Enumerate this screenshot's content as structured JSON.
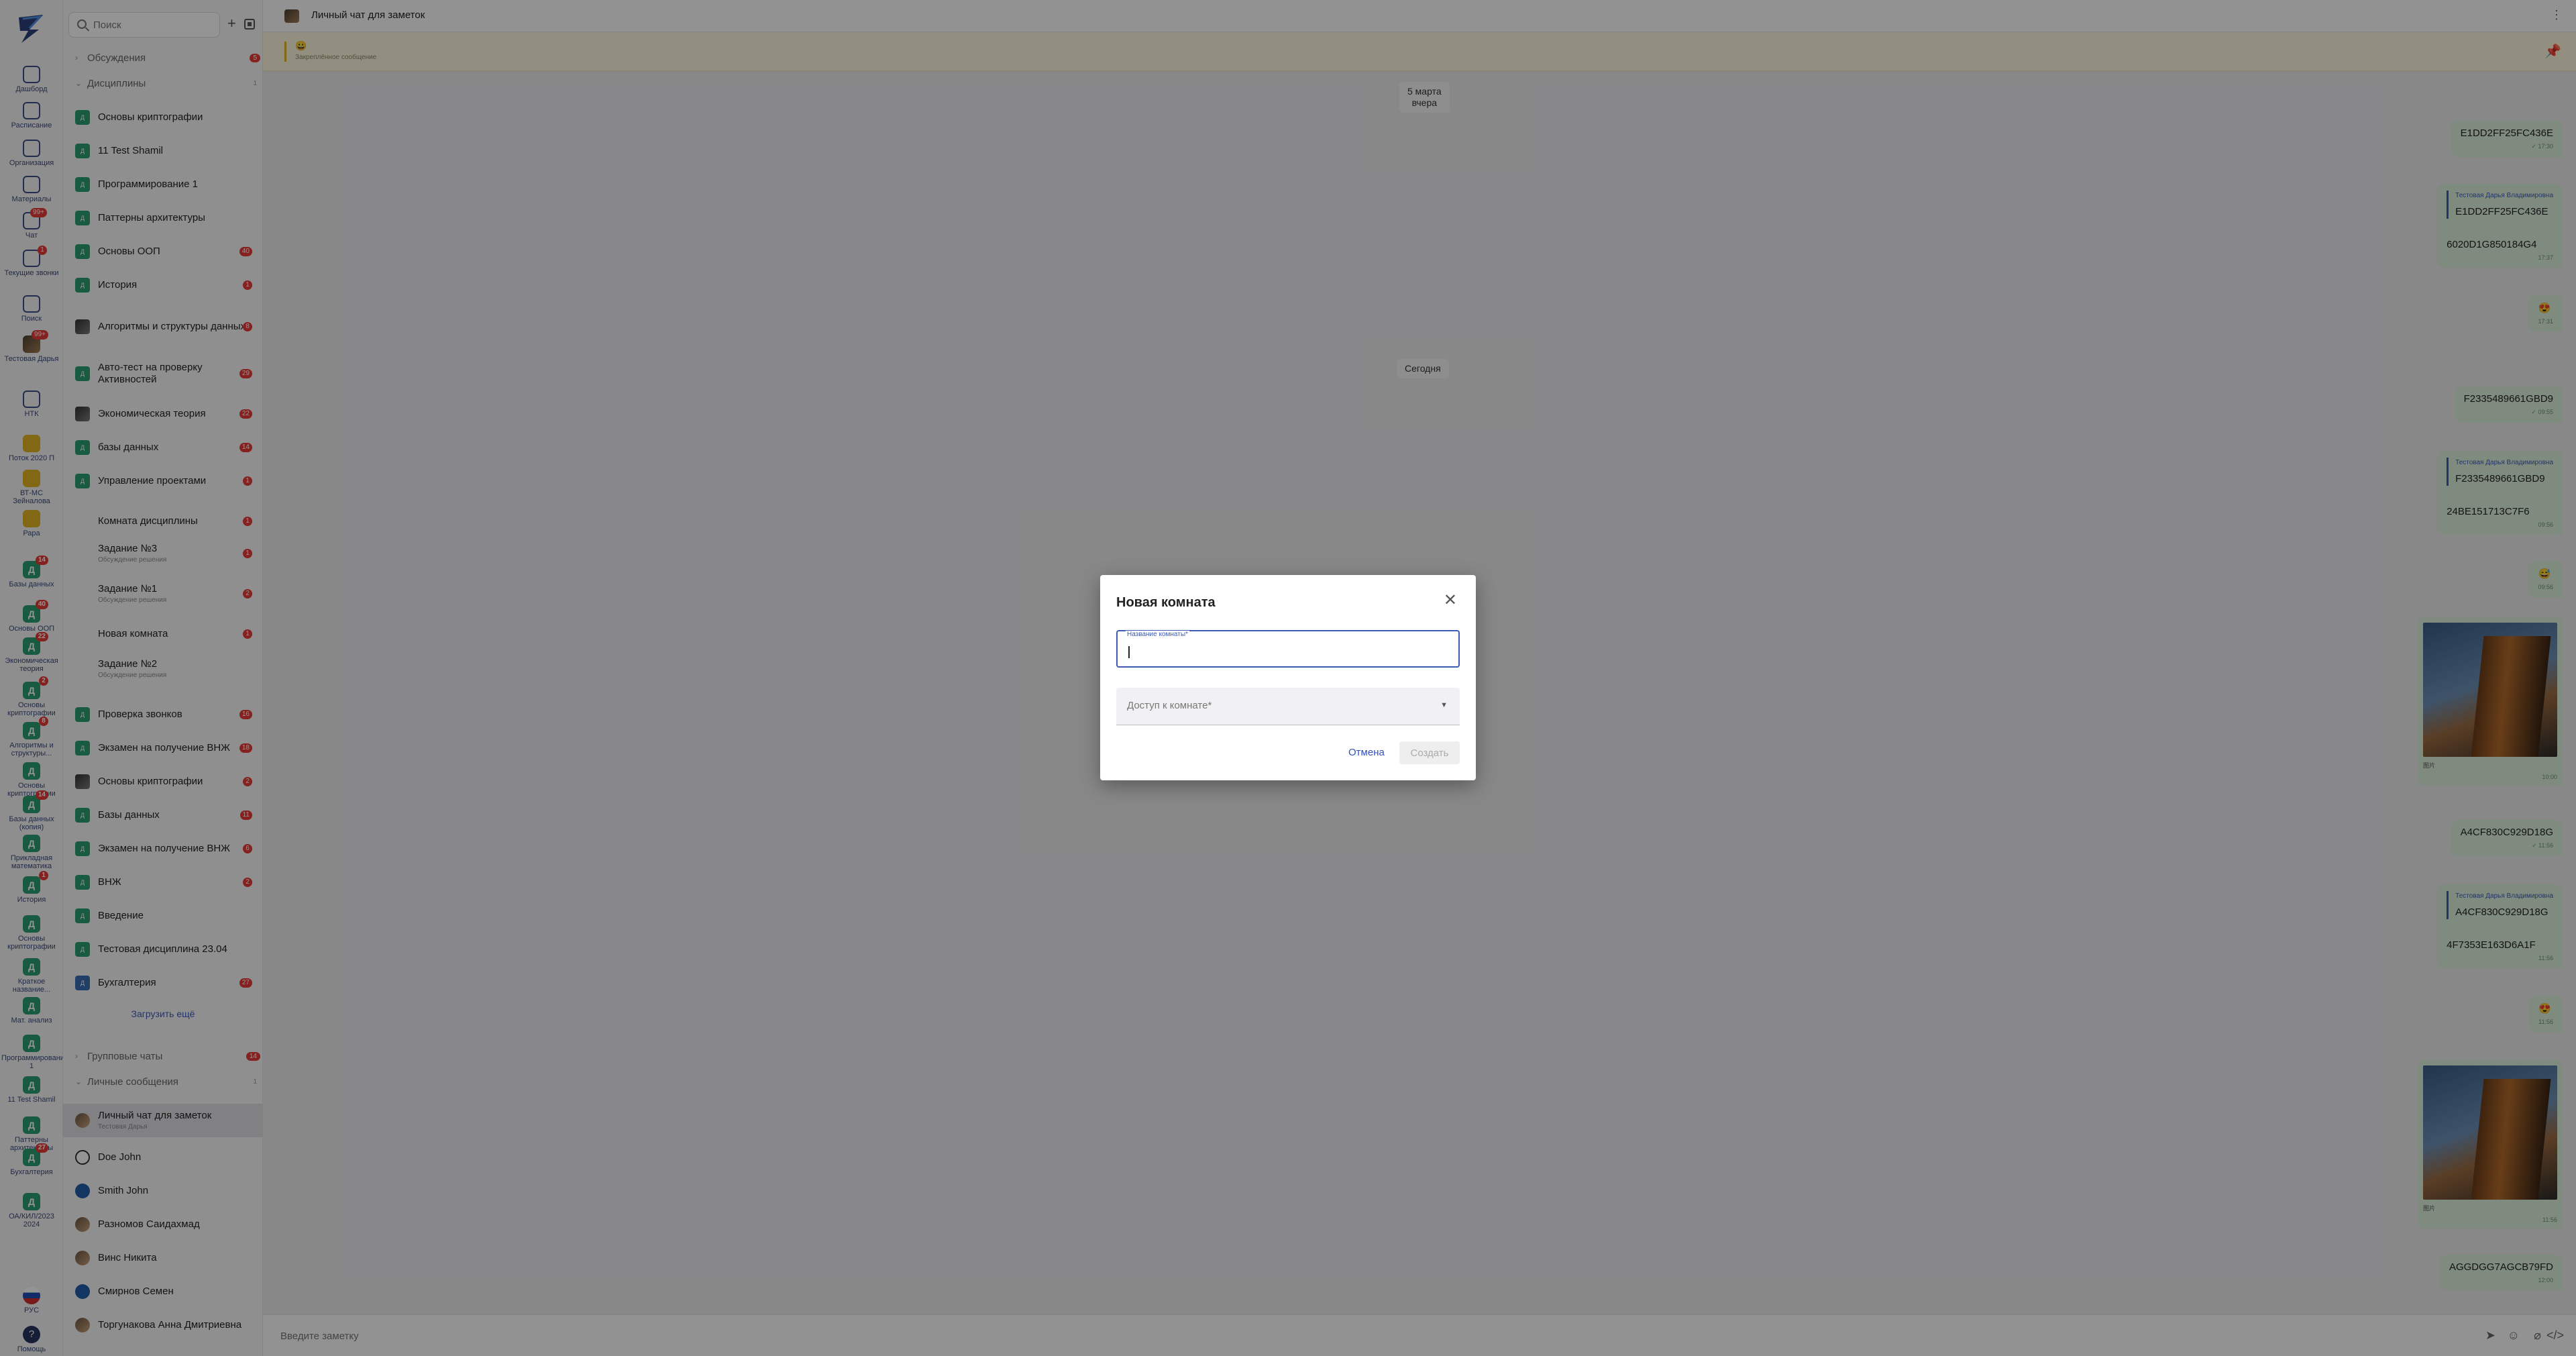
{
  "rail": {
    "items": [
      {
        "label": "Дашборд",
        "icon": "dashboard-icon",
        "badge": ""
      },
      {
        "label": "Расписание",
        "icon": "calendar-icon",
        "badge": ""
      },
      {
        "label": "Организация",
        "icon": "building-icon",
        "badge": ""
      },
      {
        "label": "Материалы",
        "icon": "book-icon",
        "badge": ""
      },
      {
        "label": "Чат",
        "icon": "chat-icon",
        "badge": "99+"
      },
      {
        "label": "Текущие звонки",
        "icon": "phone-icon",
        "badge": "1"
      },
      {
        "label": "Поиск",
        "icon": "search-icon",
        "badge": ""
      },
      {
        "label": "Тестовая Дарья",
        "icon": "avatar-icon",
        "badge": "99+"
      },
      {
        "label": "НТК",
        "icon": "user-icon",
        "badge": ""
      },
      {
        "label": "Поток 2020 П",
        "icon": "group-icon",
        "badge": ""
      },
      {
        "label": "ВТ-МС Зейналова",
        "icon": "group-icon",
        "badge": ""
      },
      {
        "label": "Рара",
        "icon": "group-icon",
        "badge": ""
      },
      {
        "label": "Базы данных",
        "icon": "discipline-icon",
        "badge": "14"
      },
      {
        "label": "Основы ООП",
        "icon": "discipline-icon",
        "badge": "40"
      },
      {
        "label": "Экономическая теория",
        "icon": "discipline-icon",
        "badge": "22"
      },
      {
        "label": "Основы криптографии",
        "icon": "discipline-icon",
        "badge": "2"
      },
      {
        "label": "Алгоритмы и структуры...",
        "icon": "discipline-icon",
        "badge": "8"
      },
      {
        "label": "Основы криптографии",
        "icon": "discipline-icon",
        "badge": ""
      },
      {
        "label": "Базы данных (копия)",
        "icon": "discipline-icon",
        "badge": "14"
      },
      {
        "label": "Прикладная математика",
        "icon": "discipline-icon",
        "badge": ""
      },
      {
        "label": "История",
        "icon": "discipline-icon",
        "badge": "1"
      },
      {
        "label": "Основы криптографии",
        "icon": "discipline-icon",
        "badge": ""
      },
      {
        "label": "Краткое название...",
        "icon": "discipline-icon",
        "badge": ""
      },
      {
        "label": "Мат. анализ",
        "icon": "discipline-icon",
        "badge": ""
      },
      {
        "label": "Программирование 1",
        "icon": "discipline-icon",
        "badge": ""
      },
      {
        "label": "11 Test Shamil",
        "icon": "discipline-icon",
        "badge": ""
      },
      {
        "label": "Паттерны архитектуры",
        "icon": "discipline-icon",
        "badge": ""
      },
      {
        "label": "Бухгалтерия",
        "icon": "discipline-icon",
        "badge": "27"
      },
      {
        "label": "ОА/КИЛ/2023 2024",
        "icon": "discipline-icon",
        "badge": ""
      },
      {
        "label": "РУС",
        "icon": "flag-ru-icon",
        "badge": ""
      },
      {
        "label": "Помощь",
        "icon": "help-icon",
        "badge": ""
      }
    ]
  },
  "sidebar": {
    "search_placeholder": "Поиск",
    "sections": {
      "discussions": {
        "label": "Обсуждения",
        "badge": "5"
      },
      "disciplines": {
        "label": "Дисциплины",
        "badge": "1"
      },
      "group_chats": {
        "label": "Групповые чаты",
        "badge": "14"
      },
      "personal": {
        "label": "Личные сообщения",
        "badge": "1"
      }
    },
    "items": [
      {
        "title": "Основы криптографии",
        "sub": "",
        "badge": "",
        "kind": "disc"
      },
      {
        "title": "11 Test Shamil",
        "sub": "",
        "badge": "",
        "kind": "disc"
      },
      {
        "title": "Программирование 1",
        "sub": "",
        "badge": "",
        "kind": "disc"
      },
      {
        "title": "Паттерны архитектуры",
        "sub": "",
        "badge": "",
        "kind": "disc"
      },
      {
        "title": "Основы ООП",
        "sub": "",
        "badge": "40",
        "kind": "disc"
      },
      {
        "title": "История",
        "sub": "",
        "badge": "1",
        "kind": "disc"
      },
      {
        "title": "Алгоритмы и структуры данных",
        "sub": "",
        "badge": "8",
        "kind": "photo2"
      },
      {
        "title": "Авто-тест на проверку Активностей",
        "sub": "",
        "badge": "29",
        "kind": "disc"
      },
      {
        "title": "Экономическая теория",
        "sub": "",
        "badge": "22",
        "kind": "photo2"
      },
      {
        "title": "базы данных",
        "sub": "",
        "badge": "14",
        "kind": "disc"
      },
      {
        "title": "Управление проектами",
        "sub": "",
        "badge": "1",
        "kind": "disc"
      },
      {
        "title": "Комната дисциплины",
        "sub": "",
        "badge": "1",
        "kind": "ghost"
      },
      {
        "title": "Задание №3",
        "sub": "Обсуждение решения",
        "badge": "1",
        "kind": "ghost"
      },
      {
        "title": "Задание №1",
        "sub": "Обсуждение решения",
        "badge": "2",
        "kind": "ghost"
      },
      {
        "title": "Новая комната",
        "sub": "",
        "badge": "1",
        "kind": "ghost"
      },
      {
        "title": "Задание №2",
        "sub": "Обсуждение решения",
        "badge": "",
        "kind": "ghost"
      },
      {
        "title": "Проверка звонков",
        "sub": "",
        "badge": "16",
        "kind": "disc"
      },
      {
        "title": "Экзамен на получение ВНЖ",
        "sub": "",
        "badge": "18",
        "kind": "disc"
      },
      {
        "title": "Основы криптографии",
        "sub": "",
        "badge": "2",
        "kind": "photo2"
      },
      {
        "title": "Базы данных",
        "sub": "",
        "badge": "11",
        "kind": "disc"
      },
      {
        "title": "Экзамен на получение ВНЖ",
        "sub": "",
        "badge": "6",
        "kind": "disc"
      },
      {
        "title": "ВНЖ",
        "sub": "",
        "badge": "2",
        "kind": "disc"
      },
      {
        "title": "Введение",
        "sub": "",
        "badge": "",
        "kind": "disc"
      },
      {
        "title": "Тестовая дисциплина 23.04",
        "sub": "",
        "badge": "",
        "kind": "disc"
      },
      {
        "title": "Бухгалтерия",
        "sub": "",
        "badge": "27",
        "kind": "disc-blue"
      }
    ],
    "load_more": "Загрузить ещё",
    "personal_items": [
      {
        "title": "Личный чат для заметок",
        "sub": "Тестовая Дарья",
        "badge": "",
        "kind": "photo"
      },
      {
        "title": "Doe John",
        "sub": "",
        "badge": "",
        "kind": "round"
      },
      {
        "title": "Smith John",
        "sub": "",
        "badge": "",
        "kind": "blue"
      },
      {
        "title": "Разномов Саидахмад",
        "sub": "",
        "badge": "",
        "kind": "photo"
      },
      {
        "title": "Винс Никита",
        "sub": "",
        "badge": "",
        "kind": "photo"
      },
      {
        "title": "Смирнов Семен",
        "sub": "",
        "badge": "",
        "kind": "blue"
      },
      {
        "title": "Торгунакова Анна Дмитриевна",
        "sub": "",
        "badge": "",
        "kind": "photo"
      }
    ]
  },
  "chat": {
    "title": "Личный чат для заметок",
    "pinned_emoji": "😀",
    "pinned_label": "Закреплённое сообщение",
    "date_1": "5 марта вчера",
    "date_1_line1": "5 марта",
    "date_1_line2": "вчера",
    "date_2": "Сегодня",
    "messages": [
      {
        "text": "E1DD2FF25FC436E",
        "time": "✓ 17:30"
      },
      {
        "reply_name": "Тестовая Дарья Владимировна",
        "reply_text": "E1DD2FF25FC436E",
        "text": "6020D1G850184G4",
        "time": "17:37"
      },
      {
        "text": "😍",
        "time": "17:31"
      },
      {
        "text": "F2335489661GBD9",
        "time": "✓ 09:55"
      },
      {
        "reply_name": "Тестовая Дарья Владимировна",
        "reply_text": "F2335489661GBD9",
        "text": "24BE151713C7F6",
        "time": "09:56"
      },
      {
        "text": "😅",
        "time": "09:56"
      },
      {
        "image_label": "图片",
        "time": "10:00"
      },
      {
        "text": "A4CF830C929D18G",
        "time": "✓ 11:56"
      },
      {
        "reply_name": "Тестовая Дарья Владимировна",
        "reply_text": "A4CF830C929D18G",
        "text": "4F7353E163D6A1F",
        "time": "11:56"
      },
      {
        "text": "😍",
        "time": "11:56"
      },
      {
        "image_label": "图片",
        "time": "11:56"
      },
      {
        "text": "AGGDGG7AGCB79FD",
        "time": "12:00"
      }
    ],
    "composer_placeholder": "Введите заметку"
  },
  "modal": {
    "title": "Новая комната",
    "name_label": "Название комнаты*",
    "name_value": "",
    "access_placeholder": "Доступ к комнате*",
    "cancel_label": "Отмена",
    "create_label": "Создать"
  },
  "colors": {
    "accent": "#3d5ab5",
    "discipline_green": "#2a9d6f",
    "badge_red": "#e53935",
    "outgoing_bubble": "#dcefdc",
    "pinned_bg": "#fbf7df"
  }
}
